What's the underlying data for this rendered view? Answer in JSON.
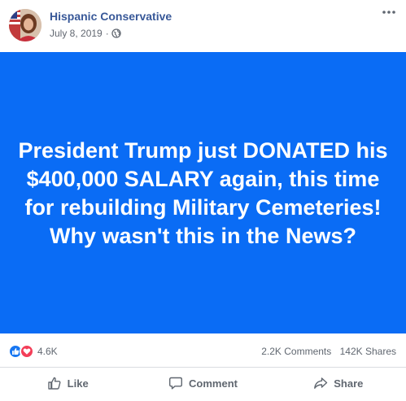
{
  "post": {
    "page_name": "Hispanic Conservative",
    "date": "July 8, 2019",
    "separator": "·",
    "privacy_icon": "globe-icon",
    "more_icon": "more-options-icon"
  },
  "image": {
    "background": "#0a6cf5",
    "text": "President Trump just DONATED his $400,000 SALARY again, this time for rebuilding Military Cemeteries! Why wasn't this in the News?"
  },
  "stats": {
    "reaction_icons": [
      "like-icon",
      "love-icon"
    ],
    "reactions_count": "4.6K",
    "comments": "2.2K Comments",
    "shares": "142K Shares"
  },
  "actions": {
    "like": "Like",
    "comment": "Comment",
    "share": "Share"
  },
  "colors": {
    "page_name": "#385898",
    "meta": "#616770",
    "like": "#1877f2",
    "love": "#f33e58"
  }
}
